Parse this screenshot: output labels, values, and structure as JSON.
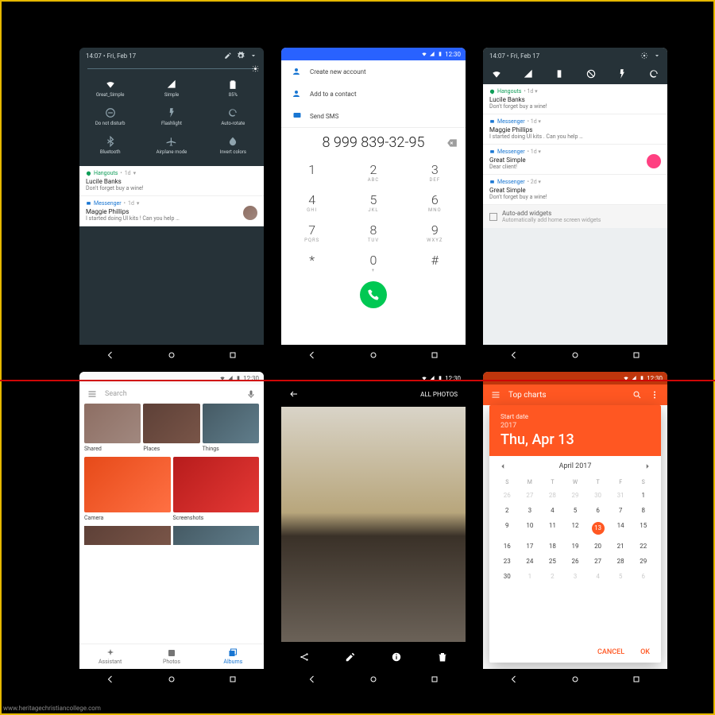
{
  "watermark": "www.heritagechristiancollege.com",
  "status_time": "12:30",
  "phone1": {
    "time_date": "14:07  •  Fri, Feb 17",
    "tiles": [
      {
        "label": "Great_Simple"
      },
      {
        "label": "Simple"
      },
      {
        "label": "85%"
      },
      {
        "label": "Do not disturb"
      },
      {
        "label": "Flashlight"
      },
      {
        "label": "Auto-rotate"
      },
      {
        "label": "Bluetooth"
      },
      {
        "label": "Airplane mode"
      },
      {
        "label": "Invert colors"
      }
    ],
    "notif1": {
      "app": "Hangouts",
      "time": "1d",
      "title": "Lucile Banks",
      "body": "Don't forget buy a wine!"
    },
    "notif2": {
      "app": "Messenger",
      "time": "1d",
      "title": "Maggie Phillips",
      "body": "I started doing UI kits ! Can you help …"
    }
  },
  "phone2": {
    "rows": {
      "create": "Create new account",
      "add": "Add to a contact",
      "sms": "Send SMS"
    },
    "number": "8 999 839-32-95",
    "keys": [
      {
        "d": "1",
        "l": ""
      },
      {
        "d": "2",
        "l": "ABC"
      },
      {
        "d": "3",
        "l": "DEF"
      },
      {
        "d": "4",
        "l": "GHI"
      },
      {
        "d": "5",
        "l": "JKL"
      },
      {
        "d": "6",
        "l": "MNO"
      },
      {
        "d": "7",
        "l": "PQRS"
      },
      {
        "d": "8",
        "l": "TUV"
      },
      {
        "d": "9",
        "l": "WXYZ"
      },
      {
        "d": "*",
        "l": ""
      },
      {
        "d": "0",
        "l": "+"
      },
      {
        "d": "#",
        "l": ""
      }
    ]
  },
  "phone3": {
    "time_date": "14:07  •  Fri, Feb 17",
    "n": [
      {
        "app": "Hangouts",
        "time": "1d",
        "title": "Lucile Banks",
        "body": "Don't forget buy a wine!"
      },
      {
        "app": "Messenger",
        "time": "1d",
        "title": "Maggie Phillips",
        "body": "I started doing UI kits . Can you help …"
      },
      {
        "app": "Messenger",
        "time": "1d",
        "title": "Great Simple",
        "body": "Dear client!"
      },
      {
        "app": "Messenger",
        "time": "2d",
        "title": "Great Simple",
        "body": "Don't forget buy a wine!"
      }
    ],
    "autoadd_title": "Auto-add widgets",
    "autoadd_body": "Automatically add home screen widgets"
  },
  "phone4": {
    "search_placeholder": "Search",
    "cells": [
      {
        "l": "Shared"
      },
      {
        "l": "Places"
      },
      {
        "l": "Things"
      }
    ],
    "big": [
      {
        "l": "Camera"
      },
      {
        "l": "Screenshots"
      }
    ],
    "tabs": {
      "a": "Assistant",
      "p": "Photos",
      "al": "Albums"
    }
  },
  "phone5": {
    "all": "ALL PHOTOS"
  },
  "phone6": {
    "app_title": "Top charts",
    "start_label": "Start date",
    "year": "2017",
    "date": "Thu, Apr 13",
    "month": "April 2017",
    "dh": [
      "S",
      "M",
      "T",
      "W",
      "T",
      "F",
      "S"
    ],
    "days": [
      26,
      27,
      28,
      29,
      30,
      31,
      1,
      2,
      3,
      4,
      5,
      6,
      7,
      8,
      9,
      10,
      11,
      12,
      13,
      14,
      15,
      16,
      17,
      18,
      19,
      20,
      21,
      22,
      23,
      24,
      25,
      26,
      27,
      28,
      29,
      30,
      1,
      2,
      3,
      4,
      5,
      6
    ],
    "selected": 13,
    "cancel": "CANCEL",
    "ok": "OK"
  }
}
